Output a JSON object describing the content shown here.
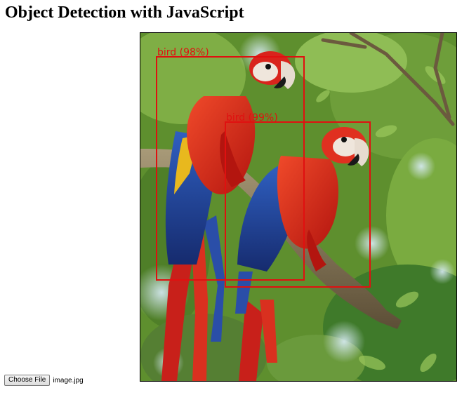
{
  "page": {
    "title": "Object Detection with JavaScript"
  },
  "file_input": {
    "button_label": "Choose File",
    "file_name": "image.jpg"
  },
  "detections": [
    {
      "label": "bird (98%)"
    },
    {
      "label": "bird (99%)"
    }
  ],
  "colors": {
    "box": "#e01010",
    "foliage": "#5e8f2e",
    "parrot_red": "#d9241c",
    "parrot_blue": "#1f3f9e",
    "parrot_yellow": "#e8b81e",
    "branch": "#7a6a4c"
  }
}
